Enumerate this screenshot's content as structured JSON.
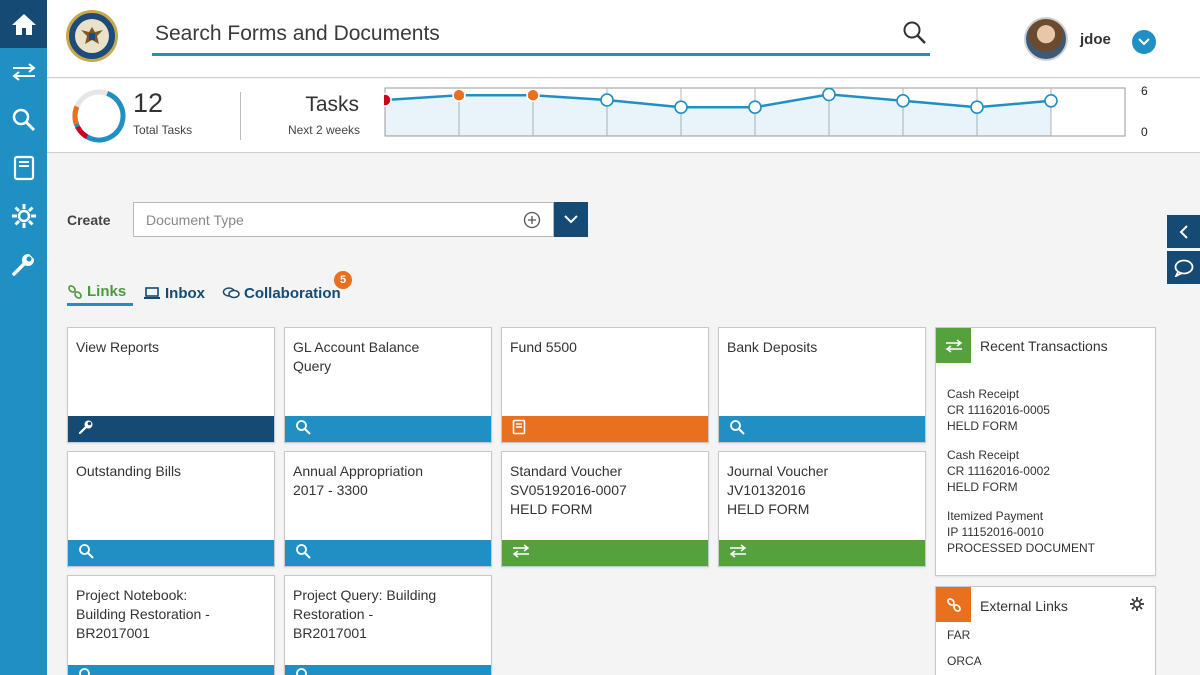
{
  "header": {
    "search_placeholder": "Search Forms and Documents",
    "username": "jdoe"
  },
  "tasks": {
    "total": "12",
    "total_label": "Total Tasks",
    "title": "Tasks",
    "subtitle": "Next 2 weeks",
    "y_max_label": "6",
    "y_min_label": "0"
  },
  "chart_data": {
    "type": "line",
    "x": [
      1,
      2,
      3,
      4,
      5,
      6,
      7,
      8,
      9,
      10,
      11
    ],
    "values": [
      4.5,
      5.1,
      5.1,
      4.5,
      3.6,
      3.6,
      5.2,
      4.4,
      3.6,
      4.4,
      null
    ],
    "point_status": [
      "overdue",
      "due-soon",
      "due-soon",
      "normal",
      "normal",
      "normal",
      "normal",
      "normal",
      "normal",
      "normal"
    ],
    "ylim": [
      0,
      6
    ],
    "grid": true,
    "colors": {
      "line": "#1f8fc4",
      "overdue": "#d0021b",
      "due-soon": "#e8701e",
      "normal": "#ffffff"
    }
  },
  "create": {
    "label": "Create",
    "doc_type_placeholder": "Document Type"
  },
  "tabs": {
    "links": "Links",
    "inbox": "Inbox",
    "collaboration": "Collaboration",
    "collaboration_badge": "5"
  },
  "cards": [
    {
      "lines": [
        "View Reports"
      ],
      "icon": "wrench-icon",
      "color": "#144a73"
    },
    {
      "lines": [
        "GL Account Balance",
        "Query"
      ],
      "icon": "search-icon",
      "color": "#1f8fc4"
    },
    {
      "lines": [
        "Fund 5500"
      ],
      "icon": "book-icon",
      "color": "#e8701e"
    },
    {
      "lines": [
        "Bank Deposits"
      ],
      "icon": "search-icon",
      "color": "#1f8fc4"
    },
    {
      "lines": [
        "Outstanding Bills"
      ],
      "icon": "search-icon",
      "color": "#1f8fc4"
    },
    {
      "lines": [
        "Annual Appropriation",
        "2017 - 3300"
      ],
      "icon": "search-icon",
      "color": "#1f8fc4"
    },
    {
      "lines": [
        "Standard Voucher",
        "SV05192016-0007",
        "HELD FORM"
      ],
      "icon": "transfer-icon",
      "color": "#55a13e"
    },
    {
      "lines": [
        "Journal Voucher",
        "JV10132016",
        "HELD FORM"
      ],
      "icon": "transfer-icon",
      "color": "#55a13e"
    },
    {
      "lines": [
        "Project Notebook:",
        "Building Restoration -",
        "BR2017001"
      ],
      "icon": "search-icon",
      "color": "#1f8fc4"
    },
    {
      "lines": [
        "Project Query: Building",
        "Restoration -",
        "BR2017001"
      ],
      "icon": "search-icon",
      "color": "#1f8fc4"
    }
  ],
  "recent": {
    "title": "Recent Transactions",
    "items": [
      {
        "type": "Cash Receipt",
        "id": "CR 11162016-0005",
        "status": "HELD FORM"
      },
      {
        "type": "Cash Receipt",
        "id": "CR 11162016-0002",
        "status": "HELD FORM"
      },
      {
        "type": "Itemized Payment",
        "id": "IP 11152016-0010",
        "status": "PROCESSED DOCUMENT"
      }
    ]
  },
  "external": {
    "title": "External Links",
    "links": [
      "FAR",
      "ORCA"
    ]
  },
  "colors": {
    "rail": "#1f8fc4",
    "navy": "#144a73",
    "green": "#55a13e",
    "orange": "#e8701e"
  }
}
